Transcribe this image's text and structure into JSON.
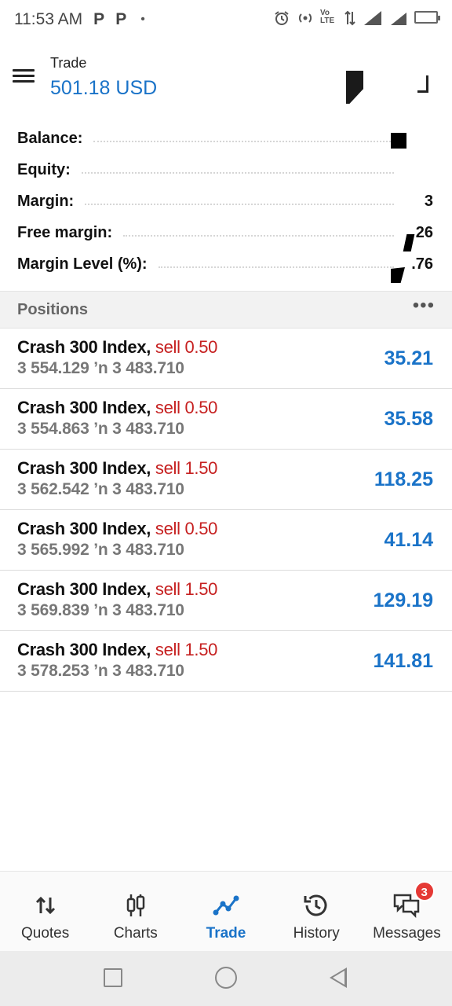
{
  "status_bar": {
    "time": "11:53 AM",
    "notif_icons": [
      "P",
      "P"
    ],
    "dot": "•",
    "volte": "Vo LTE",
    "network": "4G"
  },
  "header": {
    "title": "Trade",
    "balance": "501.18 USD"
  },
  "summary": {
    "balance_label": "Balance:",
    "balance_value": "",
    "equity_label": "Equity:",
    "equity_value": "",
    "margin_label": "Margin:",
    "margin_value": "3",
    "free_margin_label": "Free margin:",
    "free_margin_value": "26",
    "margin_level_label": "Margin Level (%):",
    "margin_level_value": ".76"
  },
  "positions": {
    "title": "Positions",
    "more": "•••",
    "rows": [
      {
        "symbol": "Crash 300 Index,",
        "side": "sell 0.50",
        "prices": "3 554.129 ’n  3 483.710",
        "profit": "35.21"
      },
      {
        "symbol": "Crash 300 Index,",
        "side": "sell 0.50",
        "prices": "3 554.863 ’n  3 483.710",
        "profit": "35.58"
      },
      {
        "symbol": "Crash 300 Index,",
        "side": "sell 1.50",
        "prices": "3 562.542 ’n  3 483.710",
        "profit": "118.25"
      },
      {
        "symbol": "Crash 300 Index,",
        "side": "sell 0.50",
        "prices": "3 565.992 ’n  3 483.710",
        "profit": "41.14"
      },
      {
        "symbol": "Crash 300 Index,",
        "side": "sell 1.50",
        "prices": "3 569.839 ’n  3 483.710",
        "profit": "129.19"
      },
      {
        "symbol": "Crash 300 Index,",
        "side": "sell 1.50",
        "prices": "3 578.253 ’n  3 483.710",
        "profit": "141.81"
      }
    ]
  },
  "bottom_nav": {
    "items": [
      {
        "label": "Quotes",
        "icon": "quotes-arrows-icon"
      },
      {
        "label": "Charts",
        "icon": "candlestick-icon"
      },
      {
        "label": "Trade",
        "icon": "trade-line-icon",
        "active": true
      },
      {
        "label": "History",
        "icon": "history-clock-icon"
      },
      {
        "label": "Messages",
        "icon": "chat-bubbles-icon",
        "badge": "3"
      }
    ]
  },
  "colors": {
    "accent": "#1a73c8",
    "sell": "#c62020",
    "badge": "#e53935"
  }
}
